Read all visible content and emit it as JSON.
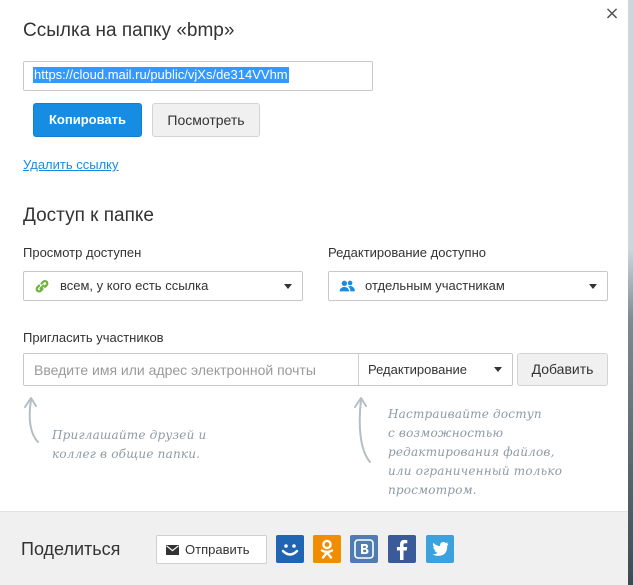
{
  "dialog": {
    "title": "Ссылка на папку «bmp»",
    "close_icon": "close-icon"
  },
  "link": {
    "url": "https://cloud.mail.ru/public/vjXs/de314VVhm",
    "copy_label": "Копировать",
    "view_label": "Посмотреть",
    "delete_label": "Удалить ссылку"
  },
  "access": {
    "title": "Доступ к папке",
    "view_label": "Просмотр доступен",
    "view_value": "всем, у кого есть ссылка",
    "edit_label": "Редактирование доступно",
    "edit_value": "отдельным участникам"
  },
  "invite": {
    "label": "Пригласить участников",
    "placeholder": "Введите имя или адрес электронной почты",
    "permission_value": "Редактирование",
    "add_label": "Добавить",
    "hint_left": [
      "Приглашайте друзей и",
      "коллег в общие папки."
    ],
    "hint_right": [
      "Настраивайте доступ",
      "с возможностью",
      "редактирования файлов,",
      "или ограниченный только",
      "просмотром."
    ]
  },
  "share": {
    "label": "Поделиться",
    "send_label": "Отправить",
    "networks": [
      {
        "name": "moi-mir",
        "color": "#1f65b3"
      },
      {
        "name": "odnoklassniki",
        "color": "#f18d00"
      },
      {
        "name": "vkontakte",
        "color": "#4f7db3"
      },
      {
        "name": "facebook",
        "color": "#3b5a9a"
      },
      {
        "name": "twitter",
        "color": "#3ba2df"
      }
    ]
  },
  "colors": {
    "accent": "#168de2",
    "hint": "#8e9aa3",
    "link_icon": "#6fb23f",
    "users_icon": "#168de2"
  }
}
